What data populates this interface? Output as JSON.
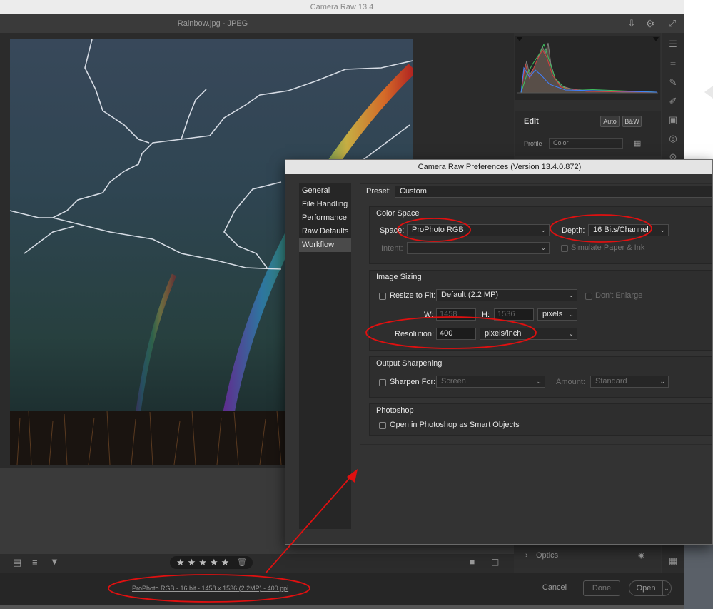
{
  "window": {
    "title": "Camera Raw 13.4",
    "document": "Rainbow.jpg  -  JPEG"
  },
  "edit": {
    "title": "Edit",
    "auto": "Auto",
    "bw": "B&W",
    "profile_label": "Profile",
    "profile_value": "Color"
  },
  "optics": {
    "label": "Optics"
  },
  "footer": {
    "workflow_link": "ProPhoto RGB - 16 bit - 1458 x 1536 (2.2MP) - 400 ppi",
    "cancel": "Cancel",
    "done": "Done",
    "open": "Open"
  },
  "rating": {
    "stars": "★★★★★"
  },
  "prefs": {
    "title": "Camera Raw Preferences  (Version 13.4.0.872)",
    "nav": [
      "General",
      "File Handling",
      "Performance",
      "Raw Defaults",
      "Workflow"
    ],
    "selected_nav": "Workflow",
    "preset_label": "Preset:",
    "preset_value": "Custom",
    "color_space": {
      "title": "Color Space",
      "space_label": "Space:",
      "space_value": "ProPhoto RGB",
      "depth_label": "Depth:",
      "depth_value": "16 Bits/Channel",
      "intent_label": "Intent:",
      "intent_value": "",
      "simulate_label": "Simulate Paper & Ink"
    },
    "image_sizing": {
      "title": "Image Sizing",
      "resize_label": "Resize to Fit:",
      "resize_value": "Default  (2.2 MP)",
      "dont_enlarge": "Don't Enlarge",
      "w_label": "W:",
      "w_value": "1458",
      "h_label": "H:",
      "h_value": "1536",
      "units": "pixels",
      "resolution_label": "Resolution:",
      "resolution_value": "400",
      "resolution_units": "pixels/inch"
    },
    "output_sharpening": {
      "title": "Output Sharpening",
      "sharpen_label": "Sharpen For:",
      "sharpen_value": "Screen",
      "amount_label": "Amount:",
      "amount_value": "Standard"
    },
    "photoshop": {
      "title": "Photoshop",
      "smart_objects": "Open in Photoshop as Smart Objects"
    }
  },
  "colors": {
    "annotation": "#e01010",
    "dialog_bg": "#333333",
    "canvas_bg": "#2b2b2b"
  },
  "icons": [
    "export-icon",
    "gear-icon",
    "expand-icon",
    "sliders-icon",
    "crop-icon",
    "heal-icon",
    "brush-icon",
    "gradient-icon",
    "radial-icon",
    "redeye-icon",
    "eye-icon",
    "grid-icon",
    "filmstrip-icon",
    "sort-icon",
    "filter-icon",
    "trash-icon",
    "compare-icon"
  ]
}
